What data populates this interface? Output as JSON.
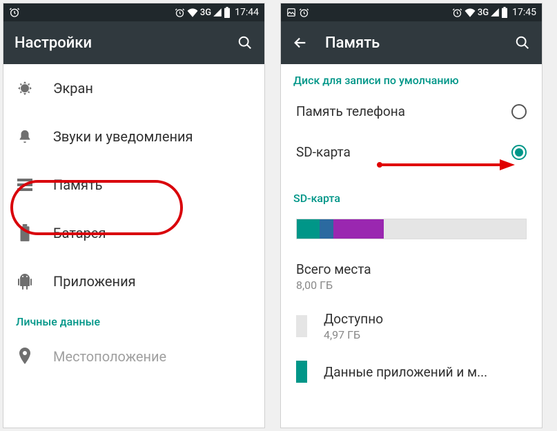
{
  "left": {
    "status": {
      "time": "17:44",
      "net": "3G"
    },
    "title": "Настройки",
    "items": [
      {
        "name": "display",
        "label": "Экран"
      },
      {
        "name": "sound",
        "label": "Звуки и уведомления"
      },
      {
        "name": "storage",
        "label": "Память"
      },
      {
        "name": "battery",
        "label": "Батарея"
      },
      {
        "name": "apps",
        "label": "Приложения"
      }
    ],
    "section_personal": "Личные данные",
    "items2": [
      {
        "name": "location",
        "label": "Местоположение"
      }
    ]
  },
  "right": {
    "status": {
      "time": "17:45",
      "net": "3G"
    },
    "title": "Память",
    "default_write_header": "Диск для записи по умолчанию",
    "radios": [
      {
        "name": "phone-storage",
        "label": "Память телефона",
        "selected": false
      },
      {
        "name": "sd-card",
        "label": "SD-карта",
        "selected": true
      }
    ],
    "sd_header": "SD-карта",
    "sd_segments": [
      {
        "color": "#009688",
        "pct": 10
      },
      {
        "color": "#2b6aa0",
        "pct": 6
      },
      {
        "color": "#9a27b0",
        "pct": 22
      },
      {
        "color": "#e5e5e5",
        "pct": 62
      }
    ],
    "total": {
      "label": "Всего места",
      "value": "8,00 ГБ"
    },
    "avail": {
      "label": "Доступно",
      "value": "4,97 ГБ",
      "color": "#e5e5e5"
    },
    "apps_data": {
      "label": "Данные приложений и м...",
      "color": "#009688"
    }
  }
}
